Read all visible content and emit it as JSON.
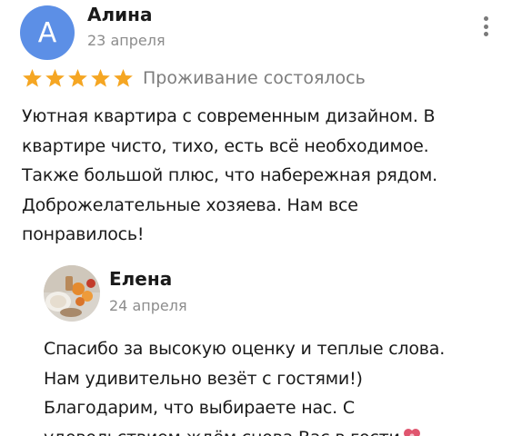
{
  "review": {
    "avatar_letter": "А",
    "avatar_color": "#5c8fe6",
    "author": "Алина",
    "date": "23 апреля",
    "rating": 5,
    "star_color": "#f5a623",
    "status": "Проживание состоялось",
    "text_lines": [
      "Уютная квартира с современным дизайном. В",
      "квартире чисто, тихо, есть всё необходимое.",
      "Также большой плюс, что набережная рядом.",
      "Доброжелательные хозяева. Нам все",
      "понравилось!"
    ],
    "menu_icon": "more-vertical-icon"
  },
  "reply": {
    "author": "Елена",
    "date": "24 апреля",
    "avatar_icon": "food-table-photo",
    "text_lines": [
      "Спасибо за высокую оценку и теплые слова.",
      "Нам удивительно везёт с гостями!)",
      "Благодарим, что выбираете нас. С",
      "удовольствием ждём снова Вас в гости"
    ],
    "trailing_icon": "flower-heart-icon"
  }
}
